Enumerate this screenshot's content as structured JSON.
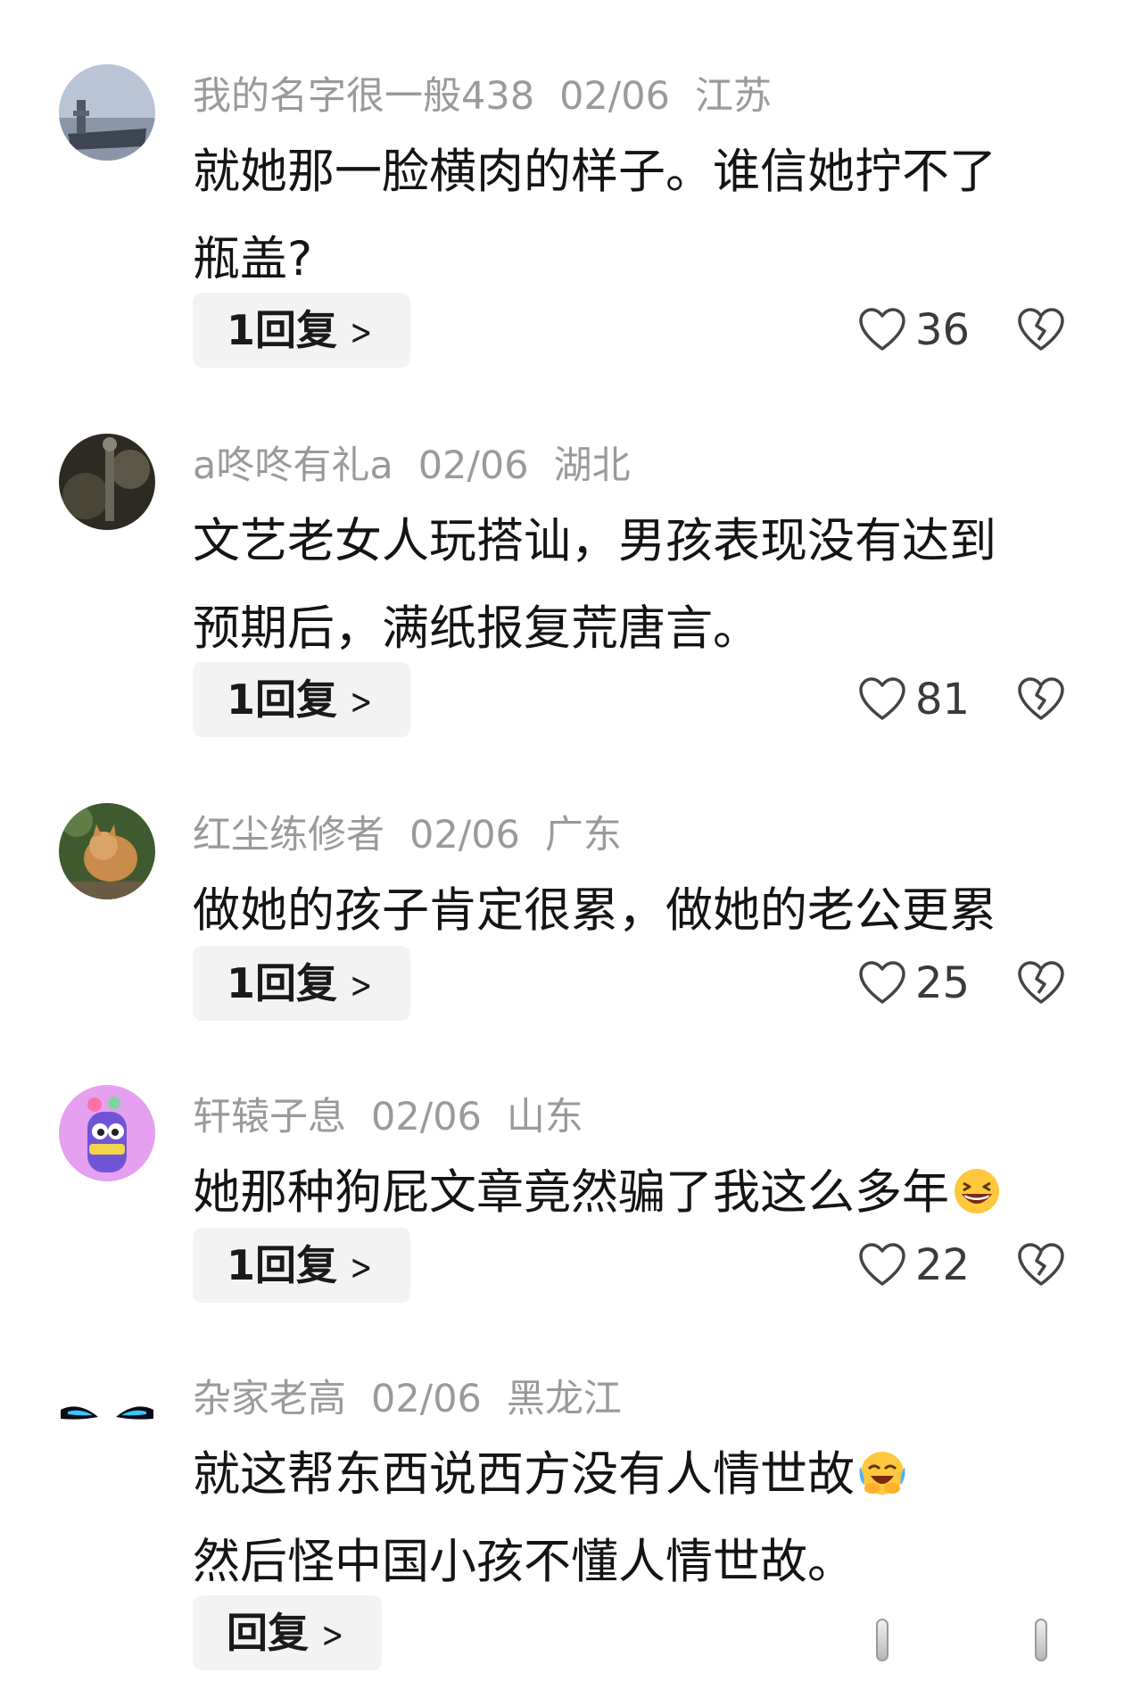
{
  "comments": [
    {
      "username": "我的名字很一般438",
      "date": "02/06",
      "location": "江苏",
      "lines": [
        "就她那一脸横肉的样子。谁信她拧不了",
        "瓶盖?"
      ],
      "reply_label": "1回复",
      "likes": "36",
      "avatar_icon": "aircraft-carrier-photo"
    },
    {
      "username": "a咚咚有礼a",
      "date": "02/06",
      "location": "湖北",
      "lines": [
        "文艺老女人玩搭讪，男孩表现没有达到",
        "预期后，满纸报复荒唐言。"
      ],
      "reply_label": "1回复",
      "likes": "81",
      "avatar_icon": "rock-photo"
    },
    {
      "username": "红尘练修者",
      "date": "02/06",
      "location": "广东",
      "lines": [
        "做她的孩子肯定很累，做她的老公更累"
      ],
      "reply_label": "1回复",
      "likes": "25",
      "avatar_icon": "cat-photo"
    },
    {
      "username": "轩辕子息",
      "date": "02/06",
      "location": "山东",
      "lines": [
        "她那种狗屁文章竟然骗了我这么多年"
      ],
      "reply_label": "1回复",
      "likes": "22",
      "avatar_icon": "purple-cartoon-avatar"
    },
    {
      "username": "杂家老高",
      "date": "02/06",
      "location": "黑龙江",
      "lines": [
        "就这帮东西说西方没有人情世故",
        "然后怪中国小孩不懂人情世故。"
      ],
      "reply_label": "回复",
      "likes": "",
      "avatar_icon": "glowing-eyes-avatar"
    }
  ],
  "icons": {
    "like": "heart-outline-icon",
    "dislike": "broken-heart-icon",
    "laugh_emoji": "grinning-squint-emoji",
    "cry_emoji": "crying-laughing-emoji"
  },
  "colors": {
    "meta_text": "#9a9a9a",
    "body_text": "#141414",
    "reply_bg": "#f3f3f3"
  }
}
